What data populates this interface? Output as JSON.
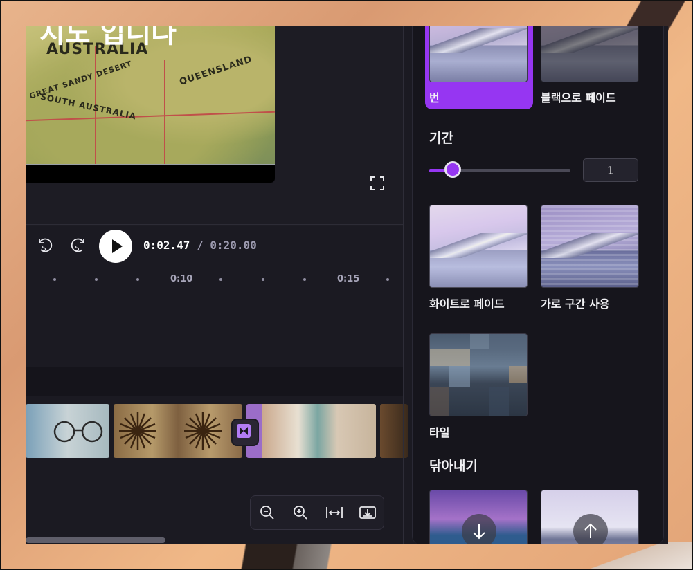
{
  "preview": {
    "overlay_title": "지도 입니다",
    "map_labels": {
      "country": "AUSTRALIA",
      "state": "QUEENSLAND",
      "desert": "GREAT SANDY DESERT",
      "south": "SOUTH AUSTRALIA"
    },
    "fullscreen_icon": "fullscreen-icon"
  },
  "player": {
    "rewind_seconds": "5",
    "forward_seconds": "5",
    "current_time": "0:02.47",
    "total_time": "/ 0:20.00"
  },
  "ruler": {
    "labels": [
      "0:10",
      "0:15"
    ]
  },
  "zoom_controls": {
    "icons": [
      "zoom-out-icon",
      "zoom-in-icon",
      "fit-width-icon",
      "expand-timeline-icon"
    ]
  },
  "panel": {
    "transitions_top": [
      {
        "label": "번",
        "selected": true
      },
      {
        "label": "블랙으로 페이드",
        "selected": false
      }
    ],
    "duration": {
      "title": "기간",
      "value": "1",
      "fraction": 0.16
    },
    "transitions_mid": [
      {
        "label": "화이트로 페이드"
      },
      {
        "label": "가로 구간 사용"
      }
    ],
    "transitions_tile": [
      {
        "label": "타일"
      }
    ],
    "wipe_section": {
      "title": "닦아내기"
    },
    "wipe_icons": [
      "arrow-down-icon",
      "arrow-up-icon"
    ]
  },
  "colors": {
    "accent": "#9636f2",
    "background": "#1b1a22"
  }
}
